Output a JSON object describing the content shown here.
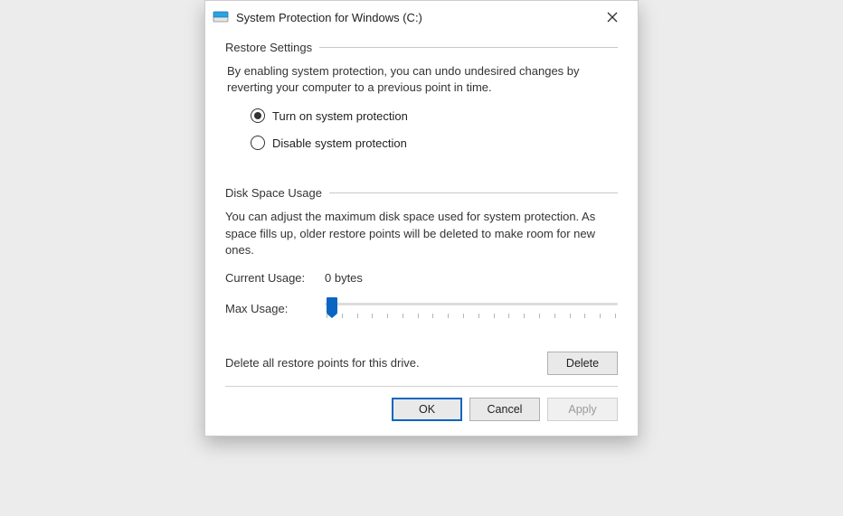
{
  "window": {
    "title": "System Protection for Windows (C:)"
  },
  "restore": {
    "heading": "Restore Settings",
    "description": "By enabling system protection, you can undo undesired changes by reverting your computer to a previous point in time.",
    "option_on": "Turn on system protection",
    "option_off": "Disable system protection",
    "selected": "on"
  },
  "disk": {
    "heading": "Disk Space Usage",
    "description": "You can adjust the maximum disk space used for system protection. As space fills up, older restore points will be deleted to make room for new ones.",
    "current_label": "Current Usage:",
    "current_value": "0 bytes",
    "max_label": "Max Usage:",
    "slider_percent": 2
  },
  "delete": {
    "text": "Delete all restore points for this drive.",
    "button": "Delete"
  },
  "footer": {
    "ok": "OK",
    "cancel": "Cancel",
    "apply": "Apply",
    "apply_enabled": false
  }
}
